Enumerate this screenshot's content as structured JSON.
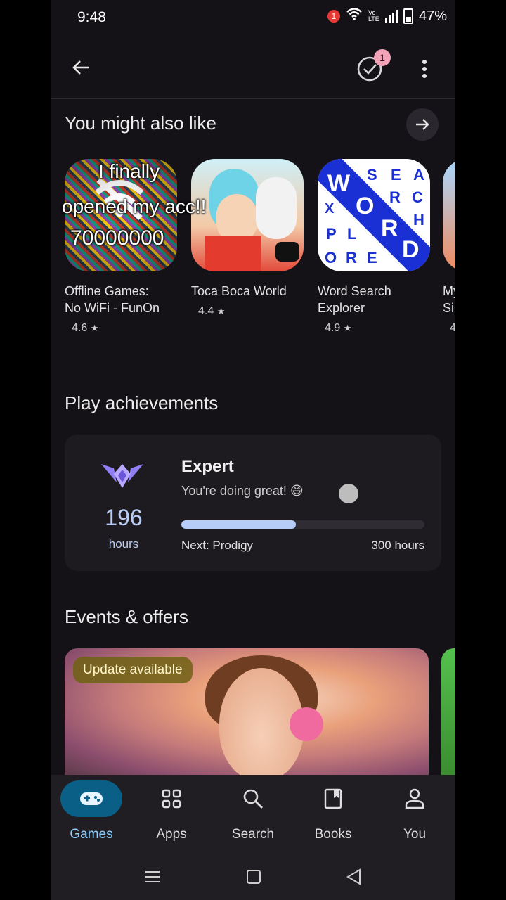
{
  "status_bar": {
    "time": "9:48",
    "notification_count": "1",
    "network_label": "Vo LTE",
    "battery": "47%"
  },
  "top_bar": {
    "tasks_badge": "1"
  },
  "recommend": {
    "title": "You might also like",
    "apps": [
      {
        "name_line1": "Offline Games:",
        "name_line2": "No WiFi - FunOn",
        "rating": "4.6",
        "overlay_line1": "I finally",
        "overlay_line2": "opened my acc!!",
        "overlay_line3": "70000000"
      },
      {
        "name_line1": "Toca Boca World",
        "name_line2": "",
        "rating": "4.4"
      },
      {
        "name_line1": "Word Search",
        "name_line2": "Explorer",
        "rating": "4.9",
        "icon_letters": [
          "W",
          "S",
          "E",
          "A",
          "O",
          "R",
          "C",
          "X",
          "R",
          "H",
          "P",
          "L",
          "D",
          "O",
          "R",
          "E"
        ]
      },
      {
        "name_line1": "My",
        "name_line2": "Si",
        "rating": "4"
      }
    ]
  },
  "achievements": {
    "title": "Play achievements",
    "hours": "196",
    "hours_label": "hours",
    "level": "Expert",
    "message": "You're doing great! 😄",
    "next_label": "Next: Prodigy",
    "goal_label": "300 hours",
    "progress": 0.47
  },
  "events": {
    "title": "Events & offers",
    "badge": "Update available"
  },
  "bottom_nav": {
    "items": [
      {
        "label": "Games",
        "icon": "gamepad-icon",
        "active": true
      },
      {
        "label": "Apps",
        "icon": "apps-grid-icon",
        "active": false
      },
      {
        "label": "Search",
        "icon": "search-icon",
        "active": false
      },
      {
        "label": "Books",
        "icon": "book-icon",
        "active": false
      },
      {
        "label": "You",
        "icon": "person-icon",
        "active": false
      }
    ]
  },
  "colors": {
    "background": "#141216",
    "accent": "#8fd0ff",
    "active_pill": "#0a5f86",
    "progress_fill": "#b5cdf7",
    "badge_bg": "#6e6214"
  }
}
